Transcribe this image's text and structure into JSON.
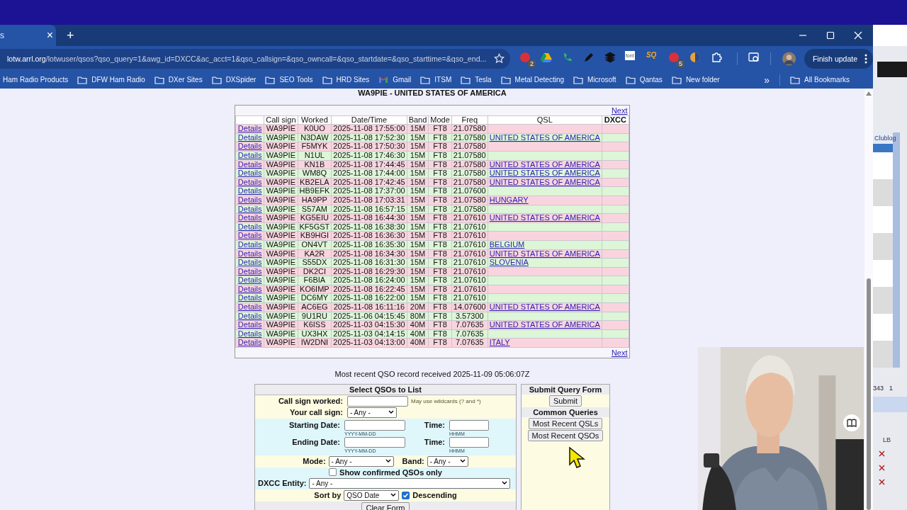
{
  "browser": {
    "tab": {
      "title": "s",
      "close": "×"
    },
    "new_tab": "+",
    "address": {
      "domain": "lotw.arrl.org",
      "path": "/lotwuser/qsos?qso_query=1&awg_id=DXCC&ac_acct=1&qso_callsign=&qso_owncall=&qso_startdate=&qso_starttime=&qso_end..."
    },
    "extensions": [
      {
        "kind": "red",
        "badge": "2"
      },
      {
        "kind": "drive"
      },
      {
        "kind": "phone"
      },
      {
        "kind": "pen"
      },
      {
        "kind": "layers"
      },
      {
        "kind": "font",
        "label": "font"
      },
      {
        "kind": "sq",
        "label": "SQ"
      },
      {
        "kind": "red",
        "badge": "5"
      },
      {
        "kind": "globe"
      },
      {
        "kind": "puzzle"
      },
      {
        "kind": "sep"
      },
      {
        "kind": "search"
      }
    ],
    "update_button": "Finish update",
    "bookmarks": [
      {
        "label": "Ham Radio Products",
        "kind": "plain"
      },
      {
        "label": "DFW Ham Radio",
        "kind": "folder"
      },
      {
        "label": "DXer Sites",
        "kind": "folder"
      },
      {
        "label": "DXSpider",
        "kind": "folder"
      },
      {
        "label": "SEO Tools",
        "kind": "folder"
      },
      {
        "label": "HRD Sites",
        "kind": "folder"
      },
      {
        "label": "Gmail",
        "kind": "gmail"
      },
      {
        "label": "ITSM",
        "kind": "folder"
      },
      {
        "label": "Tesla",
        "kind": "folder"
      },
      {
        "label": "Metal Detecting",
        "kind": "folder"
      },
      {
        "label": "Microsoft",
        "kind": "folder"
      },
      {
        "label": "Qantas",
        "kind": "folder"
      },
      {
        "label": "New folder",
        "kind": "folder"
      }
    ],
    "more_bookmarks": "»",
    "all_bookmarks": "All Bookmarks"
  },
  "page": {
    "heading": "WA9PIE - UNITED STATES OF AMERICA",
    "next_top": "Next",
    "next_bottom": "Next",
    "columns": [
      "Call sign",
      "Worked",
      "Date/Time",
      "Band",
      "Mode",
      "Freq",
      "QSL",
      "DXCC"
    ],
    "rows": [
      {
        "link": "Details",
        "call": "WA9PIE",
        "worked": "K0UO",
        "datetime": "2025-11-08 17:55:00",
        "band": "15M",
        "mode": "FT8",
        "freq": "21.07580"
      },
      {
        "link": "Details",
        "call": "WA9PIE",
        "worked": "N3DAW",
        "datetime": "2025-11-08 17:52:30",
        "band": "15M",
        "mode": "FT8",
        "freq": "21.07580",
        "qsl": "UNITED STATES OF AMERICA"
      },
      {
        "link": "Details",
        "call": "WA9PIE",
        "worked": "F5MYK",
        "datetime": "2025-11-08 17:50:30",
        "band": "15M",
        "mode": "FT8",
        "freq": "21.07580"
      },
      {
        "link": "Details",
        "call": "WA9PIE",
        "worked": "N1UL",
        "datetime": "2025-11-08 17:46:30",
        "band": "15M",
        "mode": "FT8",
        "freq": "21.07580"
      },
      {
        "link": "Details",
        "call": "WA9PIE",
        "worked": "KN1B",
        "datetime": "2025-11-08 17:44:45",
        "band": "15M",
        "mode": "FT8",
        "freq": "21.07580",
        "qsl": "UNITED STATES OF AMERICA"
      },
      {
        "link": "Details",
        "call": "WA9PIE",
        "worked": "WM8Q",
        "datetime": "2025-11-08 17:44:00",
        "band": "15M",
        "mode": "FT8",
        "freq": "21.07580",
        "qsl": "UNITED STATES OF AMERICA"
      },
      {
        "link": "Details",
        "call": "WA9PIE",
        "worked": "KB2ELA",
        "datetime": "2025-11-08 17:42:45",
        "band": "15M",
        "mode": "FT8",
        "freq": "21.07580",
        "qsl": "UNITED STATES OF AMERICA"
      },
      {
        "link": "Details",
        "call": "WA9PIE",
        "worked": "HB9EFK",
        "datetime": "2025-11-08 17:37:00",
        "band": "15M",
        "mode": "FT8",
        "freq": "21.07600"
      },
      {
        "link": "Details",
        "call": "WA9PIE",
        "worked": "HA9PP",
        "datetime": "2025-11-08 17:03:31",
        "band": "15M",
        "mode": "FT8",
        "freq": "21.07580",
        "qsl": "HUNGARY"
      },
      {
        "link": "Details",
        "call": "WA9PIE",
        "worked": "S57AM",
        "datetime": "2025-11-08 16:57:15",
        "band": "15M",
        "mode": "FT8",
        "freq": "21.07580"
      },
      {
        "link": "Details",
        "call": "WA9PIE",
        "worked": "KG5EIU",
        "datetime": "2025-11-08 16:44:30",
        "band": "15M",
        "mode": "FT8",
        "freq": "21.07610",
        "qsl": "UNITED STATES OF AMERICA"
      },
      {
        "link": "Details",
        "call": "WA9PIE",
        "worked": "KF5GST",
        "datetime": "2025-11-08 16:38:30",
        "band": "15M",
        "mode": "FT8",
        "freq": "21.07610"
      },
      {
        "link": "Details",
        "call": "WA9PIE",
        "worked": "KB9HGI",
        "datetime": "2025-11-08 16:36:30",
        "band": "15M",
        "mode": "FT8",
        "freq": "21.07610"
      },
      {
        "link": "Details",
        "call": "WA9PIE",
        "worked": "ON4VT",
        "datetime": "2025-11-08 16:35:30",
        "band": "15M",
        "mode": "FT8",
        "freq": "21.07610",
        "qsl": "BELGIUM"
      },
      {
        "link": "Details",
        "call": "WA9PIE",
        "worked": "KA2R",
        "datetime": "2025-11-08 16:34:30",
        "band": "15M",
        "mode": "FT8",
        "freq": "21.07610",
        "qsl": "UNITED STATES OF AMERICA"
      },
      {
        "link": "Details",
        "call": "WA9PIE",
        "worked": "S55DX",
        "datetime": "2025-11-08 16:31:30",
        "band": "15M",
        "mode": "FT8",
        "freq": "21.07610",
        "qsl": "SLOVENIA"
      },
      {
        "link": "Details",
        "call": "WA9PIE",
        "worked": "DK2CI",
        "datetime": "2025-11-08 16:29:30",
        "band": "15M",
        "mode": "FT8",
        "freq": "21.07610"
      },
      {
        "link": "Details",
        "call": "WA9PIE",
        "worked": "F6BIA",
        "datetime": "2025-11-08 16:24:00",
        "band": "15M",
        "mode": "FT8",
        "freq": "21.07610"
      },
      {
        "link": "Details",
        "call": "WA9PIE",
        "worked": "KO6IMP",
        "datetime": "2025-11-08 16:22:45",
        "band": "15M",
        "mode": "FT8",
        "freq": "21.07610"
      },
      {
        "link": "Details",
        "call": "WA9PIE",
        "worked": "DC6MY",
        "datetime": "2025-11-08 16:22:00",
        "band": "15M",
        "mode": "FT8",
        "freq": "21.07610"
      },
      {
        "link": "Details",
        "call": "WA9PIE",
        "worked": "AC6EG",
        "datetime": "2025-11-08 16:11:16",
        "band": "20M",
        "mode": "FT8",
        "freq": "14.07600",
        "qsl": "UNITED STATES OF AMERICA"
      },
      {
        "link": "Details",
        "call": "WA9PIE",
        "worked": "9U1RU",
        "datetime": "2025-11-06 04:15:45",
        "band": "80M",
        "mode": "FT8",
        "freq": "3.57300"
      },
      {
        "link": "Details",
        "call": "WA9PIE",
        "worked": "K6ISS",
        "datetime": "2025-11-03 04:15:30",
        "band": "40M",
        "mode": "FT8",
        "freq": "7.07635",
        "qsl": "UNITED STATES OF AMERICA"
      },
      {
        "link": "Details",
        "call": "WA9PIE",
        "worked": "UX3HX",
        "datetime": "2025-11-03 04:14:15",
        "band": "40M",
        "mode": "FT8",
        "freq": "7.07635"
      },
      {
        "link": "Details",
        "call": "WA9PIE",
        "worked": "IW2DNI",
        "datetime": "2025-11-03 04:13:00",
        "band": "40M",
        "mode": "FT8",
        "freq": "7.07635",
        "qsl": "ITALY"
      }
    ],
    "recent": "Most recent QSO record received 2025-11-09 05:06:07Z",
    "form": {
      "title": "Select QSOs to List",
      "callsign_label": "Call sign worked:",
      "wildcard_hint": "May use wildcards (? and *)",
      "own_label": "Your call sign:",
      "own_value": "- Any -",
      "start_label": "Starting Date:",
      "start_time_label": "Time:",
      "start_date_hint": "YYYY-MM-DD",
      "start_time_hint": "HHMM",
      "end_label": "Ending Date:",
      "end_time_label": "Time:",
      "end_date_hint": "YYYY-MM-DD",
      "end_time_hint": "HHMM",
      "mode_label": "Mode:",
      "mode_value": "- Any -",
      "band_label": "Band:",
      "band_value": "- Any -",
      "confirmed_label": "Show confirmed QSOs only",
      "confirmed_checked": false,
      "dxcc_label": "DXCC Entity:",
      "dxcc_value": "- Any -",
      "sort_label": "Sort by",
      "sort_value": "QSO Date",
      "descending_label": "Descending",
      "descending_checked": true,
      "clear": "Clear Form"
    },
    "side": {
      "title": "Submit Query Form",
      "submit": "Submit",
      "common": "Common Queries",
      "buttons": [
        "Most Recent QSLs",
        "Most Recent QSOs"
      ]
    }
  },
  "background_app": {
    "column": "Clublog",
    "count": "343",
    "page": "1",
    "column_2": "LB"
  }
}
